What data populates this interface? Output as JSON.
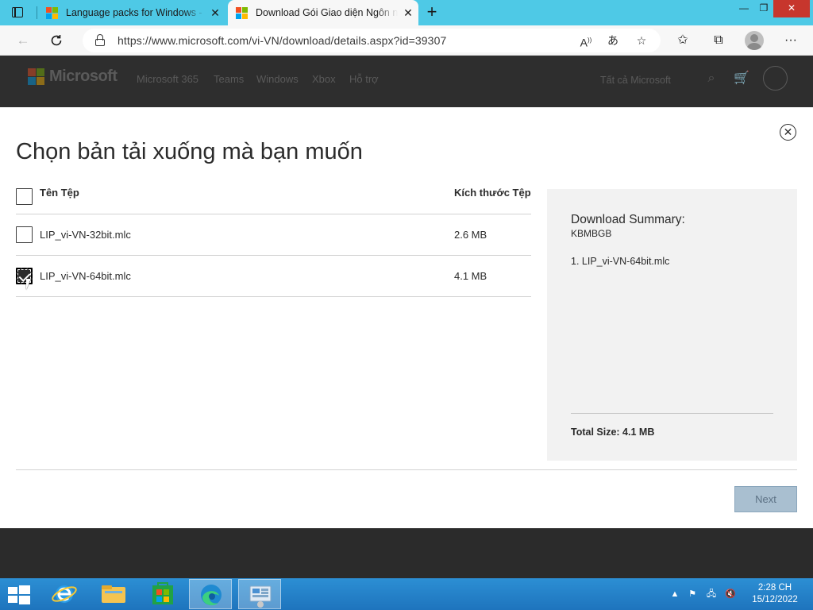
{
  "browser": {
    "tabs": [
      {
        "title": "Language packs for Windows - M",
        "active": false
      },
      {
        "title": "Download Gói Giao diện Ngôn ngữ",
        "active": true
      }
    ],
    "url": "https://www.microsoft.com/vi-VN/download/details.aspx?id=39307"
  },
  "site_header": {
    "brand": "Microsoft",
    "nav": [
      "Microsoft 365",
      "Teams",
      "Windows",
      "Xbox",
      "Hỗ trợ"
    ],
    "all_microsoft": "Tất cả Microsoft"
  },
  "modal": {
    "title": "Chọn bản tải xuống mà bạn muốn",
    "columns": {
      "name": "Tên Tệp",
      "size": "Kích thước Tệp"
    },
    "files": [
      {
        "name": "LIP_vi-VN-32bit.mlc",
        "size": "2.6 MB",
        "checked": false
      },
      {
        "name": "LIP_vi-VN-64bit.mlc",
        "size": "4.1 MB",
        "checked": true
      }
    ],
    "summary": {
      "title": "Download Summary:",
      "subtitle": "KBMBGB",
      "items": [
        "1. LIP_vi-VN-64bit.mlc"
      ],
      "total": "Total Size: 4.1 MB"
    },
    "next_label": "Next"
  },
  "taskbar": {
    "time": "2:28 CH",
    "date": "15/12/2022"
  },
  "colors": {
    "tabbar": "#4ec9e6",
    "taskbar": "#1e74bd",
    "next_button": "#a9bfd0",
    "summary_bg": "#f2f2f2"
  }
}
